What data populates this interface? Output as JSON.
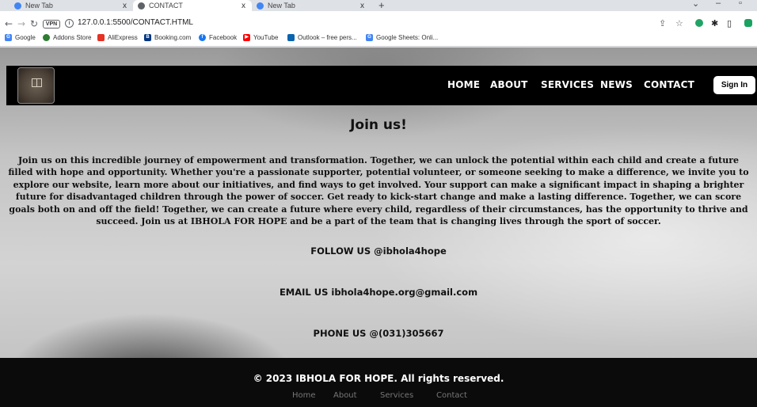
{
  "browser": {
    "tabs": [
      {
        "title": "New Tab",
        "active": false
      },
      {
        "title": "CONTACT",
        "active": true
      },
      {
        "title": "New Tab",
        "active": false
      }
    ],
    "new_tab_label": "+",
    "close_label": "x",
    "address": "127.0.0.1:5500/CONTACT.HTML",
    "vpn_label": "VPN",
    "bookmarks": [
      {
        "label": "Google",
        "icon": "google-icon",
        "color": "#4285f4"
      },
      {
        "label": "Addons Store",
        "icon": "addons-icon",
        "color": "#2e7d32"
      },
      {
        "label": "AliExpress",
        "icon": "aliexpress-icon",
        "color": "#e43225"
      },
      {
        "label": "Booking.com",
        "icon": "booking-icon",
        "color": "#003580"
      },
      {
        "label": "Facebook",
        "icon": "facebook-icon",
        "color": "#1877f2"
      },
      {
        "label": "YouTube",
        "icon": "youtube-icon",
        "color": "#ff0000"
      },
      {
        "label": "Outlook – free pers...",
        "icon": "outlook-icon",
        "color": "#0a64ad"
      },
      {
        "label": "Google Sheets: Onli...",
        "icon": "google-icon",
        "color": "#4285f4"
      }
    ]
  },
  "site": {
    "nav": [
      "HOME",
      "ABOUT",
      "SERVICES",
      "NEWS",
      "CONTACT"
    ],
    "signin_label": "Sign In",
    "title": "Join us!",
    "paragraph": "Join us on this incredible journey of empowerment and transformation. Together, we can unlock the potential within each child and create a future filled with hope and opportunity. Whether you're a passionate supporter, potential volunteer, or someone seeking to make a difference, we invite you to explore our website, learn more about our initiatives, and find ways to get involved. Your support can make a significant impact in shaping a brighter future for disadvantaged children through the power of soccer. Get ready to kick-start change and make a lasting difference. Together, we can score goals both on and off the field! Together, we can create a future where every child, regardless of their circumstances, has the opportunity to thrive and succeed. Join us at IBHOLA FOR HOPE and be a part of the team that is changing lives through the sport of soccer.",
    "follow": "FOLLOW US @ibhola4hope",
    "email": "EMAIL US ibhola4hope.org@gmail.com",
    "phone": "PHONE US @(031)305667",
    "copyright": "© 2023 IBHOLA FOR HOPE. All rights reserved.",
    "footer_links": [
      "Home",
      "About",
      "Services",
      "Contact"
    ]
  }
}
